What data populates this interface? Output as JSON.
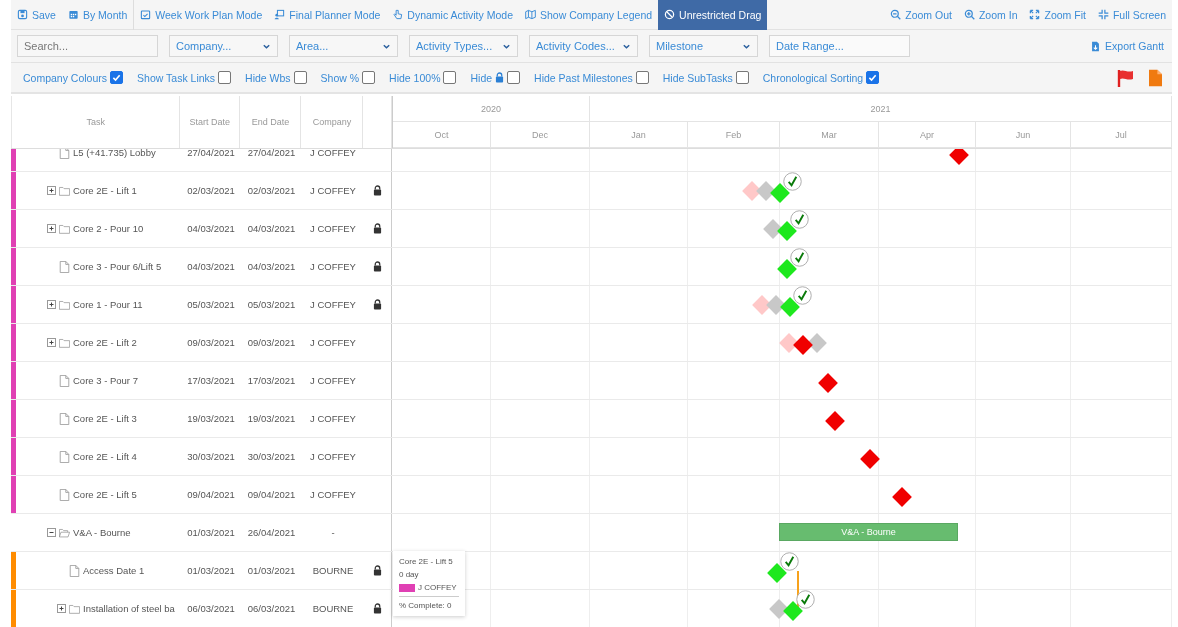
{
  "toolbar": {
    "left": [
      {
        "label": "Save",
        "kind": "save",
        "selected": false
      },
      {
        "label": "By Month",
        "kind": "calendar",
        "selected": false
      },
      {
        "label": "Week Work Plan Mode",
        "kind": "calendar-check",
        "selected": false
      },
      {
        "label": "Final Planner Mode",
        "kind": "presenter",
        "selected": false
      },
      {
        "label": "Dynamic Activity Mode",
        "kind": "hand",
        "selected": false
      },
      {
        "label": "Show Company Legend",
        "kind": "map",
        "selected": false
      },
      {
        "label": "Unrestricted Drag",
        "kind": "ban",
        "selected": true
      }
    ],
    "right": [
      {
        "label": "Zoom Out",
        "kind": "zoom-out"
      },
      {
        "label": "Zoom In",
        "kind": "zoom-in"
      },
      {
        "label": "Zoom Fit",
        "kind": "fit"
      },
      {
        "label": "Full Screen",
        "kind": "compress"
      }
    ]
  },
  "filters": {
    "search": {
      "placeholder": "Search..."
    },
    "selects": [
      {
        "value": "Company..."
      },
      {
        "value": "Area..."
      },
      {
        "value": "Activity Types..."
      },
      {
        "value": "Activity Codes..."
      },
      {
        "value": "Milestone"
      }
    ],
    "date_range": {
      "placeholder": "Date Range..."
    },
    "export": "Export Gantt"
  },
  "options": [
    {
      "label": "Company Colours",
      "kind": "plain",
      "checked": true
    },
    {
      "label": "Show Task Links",
      "kind": "plain",
      "checked": false
    },
    {
      "label": "Hide Wbs",
      "kind": "plain",
      "checked": false
    },
    {
      "label": "Show %",
      "kind": "plain",
      "checked": false
    },
    {
      "label": "Hide 100%",
      "kind": "plain",
      "checked": false
    },
    {
      "label": "Hide",
      "kind": "lock",
      "checked": false
    },
    {
      "label": "Hide Past Milestones",
      "kind": "plain",
      "checked": false
    },
    {
      "label": "Hide SubTasks",
      "kind": "plain",
      "checked": false
    },
    {
      "label": "Chronological Sorting",
      "kind": "plain",
      "checked": true
    }
  ],
  "columns": [
    "Task",
    "Start Date",
    "End Date",
    "Company"
  ],
  "timeline": [
    {
      "label": "2020",
      "months": [
        "Oct",
        "Dec"
      ]
    },
    {
      "label": "2021",
      "months": [
        "Jan",
        "Feb",
        "Mar",
        "Apr",
        "Jun",
        "Jul"
      ]
    }
  ],
  "tasks": [
    {
      "children": [
        {
          "name": "L5 (+41.735) Lobby",
          "kind": "file",
          "start": "27/04/2021",
          "end": "27/04/2021",
          "company": "J COFFEY",
          "color": "#e040b4",
          "locked": false,
          "milestones": [
            {
              "kind": "late"
            }
          ]
        },
        {
          "name": "Core 2E - Lift 1",
          "kind": "folder",
          "expanded": false,
          "start": "02/03/2021",
          "end": "02/03/2021",
          "company": "J COFFEY",
          "color": "#e040b4",
          "locked": true,
          "milestones": [
            {
              "kind": "previous"
            },
            {
              "kind": "baseline"
            },
            {
              "kind": "done"
            }
          ]
        },
        {
          "name": "Core 2 - Pour 10",
          "kind": "folder",
          "expanded": false,
          "start": "04/03/2021",
          "end": "04/03/2021",
          "company": "J COFFEY",
          "color": "#e040b4",
          "locked": true,
          "milestones": [
            {
              "kind": "baseline"
            },
            {
              "kind": "done"
            }
          ]
        },
        {
          "name": "Core 3 - Pour 6/Lift 5",
          "kind": "file",
          "start": "04/03/2021",
          "end": "04/03/2021",
          "company": "J COFFEY",
          "color": "#e040b4",
          "locked": true,
          "milestones": [
            {
              "kind": "done"
            }
          ]
        },
        {
          "name": "Core 1 - Pour 11",
          "kind": "folder",
          "expanded": false,
          "start": "05/03/2021",
          "end": "05/03/2021",
          "company": "J COFFEY",
          "color": "#e040b4",
          "locked": true,
          "milestones": [
            {
              "kind": "previous"
            },
            {
              "kind": "baseline"
            },
            {
              "kind": "done"
            }
          ]
        },
        {
          "name": "Core 2E - Lift 2",
          "kind": "folder",
          "expanded": false,
          "start": "09/03/2021",
          "end": "09/03/2021",
          "company": "J COFFEY",
          "color": "#e040b4",
          "locked": false,
          "milestones": [
            {
              "kind": "previous"
            },
            {
              "kind": "late"
            },
            {
              "kind": "baseline"
            }
          ]
        },
        {
          "name": "Core 3 - Pour 7",
          "kind": "file",
          "start": "17/03/2021",
          "end": "17/03/2021",
          "company": "J COFFEY",
          "color": "#e040b4",
          "locked": false,
          "milestones": [
            {
              "kind": "late"
            }
          ]
        },
        {
          "name": "Core 2E - Lift 3",
          "kind": "file",
          "start": "19/03/2021",
          "end": "19/03/2021",
          "company": "J COFFEY",
          "color": "#e040b4",
          "locked": false,
          "milestones": [
            {
              "kind": "late"
            }
          ]
        },
        {
          "name": "Core 2E - Lift 4",
          "kind": "file",
          "start": "30/03/2021",
          "end": "30/03/2021",
          "company": "J COFFEY",
          "color": "#e040b4",
          "locked": false,
          "milestones": [
            {
              "kind": "late"
            }
          ]
        },
        {
          "name": "Core 2E - Lift 5",
          "kind": "file",
          "start": "09/04/2021",
          "end": "09/04/2021",
          "company": "J COFFEY",
          "color": "#e040b4",
          "locked": false,
          "milestones": [
            {
              "kind": "late"
            }
          ]
        }
      ]
    },
    {
      "name": "V&A - Bourne",
      "kind": "group",
      "expanded": true,
      "start": "01/03/2021",
      "end": "26/04/2021",
      "company": "-",
      "bar_label": "V&A - Bourne",
      "children": [
        {
          "name": "Access Date 1",
          "kind": "file",
          "start": "01/03/2021",
          "end": "01/03/2021",
          "company": "BOURNE",
          "color": "#ff8c00",
          "locked": true,
          "milestones": [
            {
              "kind": "done"
            }
          ],
          "link_to_next": true
        },
        {
          "name": "Installation of steel ba",
          "kind": "folder",
          "expanded": false,
          "start": "06/03/2021",
          "end": "06/03/2021",
          "company": "BOURNE",
          "color": "#ff8c00",
          "locked": true,
          "milestones": [
            {
              "kind": "baseline"
            },
            {
              "kind": "done"
            }
          ]
        }
      ]
    }
  ],
  "tooltip": {
    "title": "Core 2E - Lift 5",
    "duration": "0 day",
    "company": "J COFFEY",
    "color": "#e040b4",
    "complete": "% Complete: 0"
  }
}
